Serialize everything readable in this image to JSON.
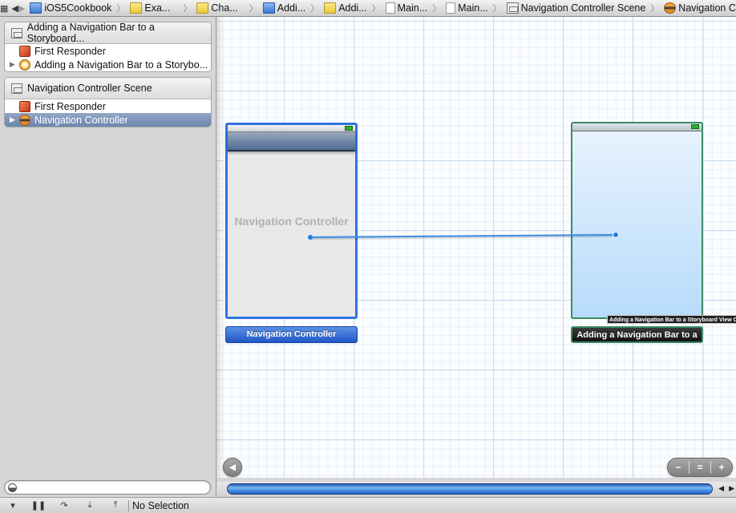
{
  "jumpbar": {
    "crumbs": [
      {
        "label": "iOS5Cookbook",
        "icon": "project-icon"
      },
      {
        "label": "Exa...",
        "icon": "folder-icon"
      },
      {
        "label": "Cha...",
        "icon": "folder-icon"
      },
      {
        "label": "Addi...",
        "icon": "project-icon"
      },
      {
        "label": "Addi...",
        "icon": "folder-icon"
      },
      {
        "label": "Main...",
        "icon": "file-icon"
      },
      {
        "label": "Main...",
        "icon": "file-icon"
      },
      {
        "label": "Navigation Controller Scene",
        "icon": "scene-icon"
      },
      {
        "label": "Navigation Controller",
        "icon": "navigation-controller-icon"
      }
    ],
    "grid_glyph": "▦",
    "back_glyph": "◀",
    "forward_glyph": "▶"
  },
  "outline": {
    "scenes": [
      {
        "title": "Adding a Navigation Bar to a Storyboard...",
        "items": [
          {
            "label": "First Responder",
            "icon": "first-responder-icon",
            "expandable": false,
            "selected": false
          },
          {
            "label": "Adding a Navigation Bar to a Storybo...",
            "icon": "view-controller-icon",
            "expandable": true,
            "selected": false
          }
        ]
      },
      {
        "title": "Navigation Controller Scene",
        "items": [
          {
            "label": "First Responder",
            "icon": "first-responder-icon",
            "expandable": false,
            "selected": false
          },
          {
            "label": "Navigation Controller",
            "icon": "navigation-controller-icon",
            "expandable": true,
            "selected": true
          }
        ]
      }
    ],
    "disclosure_glyph": "▶"
  },
  "canvas": {
    "nav_controller": {
      "placeholder": "Navigation Controller",
      "label": "Navigation Controller",
      "accent": "#2f74e0"
    },
    "root_controller": {
      "label": "Adding a Navigation Bar to a",
      "tooltip": "Adding a Navigation Bar to a Storyboard View Controller",
      "accent": "#3b8a63"
    },
    "back_glyph": "◀",
    "zoom": {
      "out": "−",
      "fit": "=",
      "in": "+"
    }
  },
  "filter": {
    "placeholder": "",
    "value": ""
  },
  "scroll": {
    "left": "◀",
    "right": "▶"
  },
  "debug": {
    "buttons": [
      {
        "name": "toggle-console-button",
        "glyph": "▾"
      },
      {
        "name": "pause-button",
        "glyph": "❚❚"
      },
      {
        "name": "step-over-button",
        "glyph": "↷"
      },
      {
        "name": "step-into-button",
        "glyph": "⤓"
      },
      {
        "name": "step-out-button",
        "glyph": "⤒"
      }
    ],
    "status": "No Selection"
  }
}
